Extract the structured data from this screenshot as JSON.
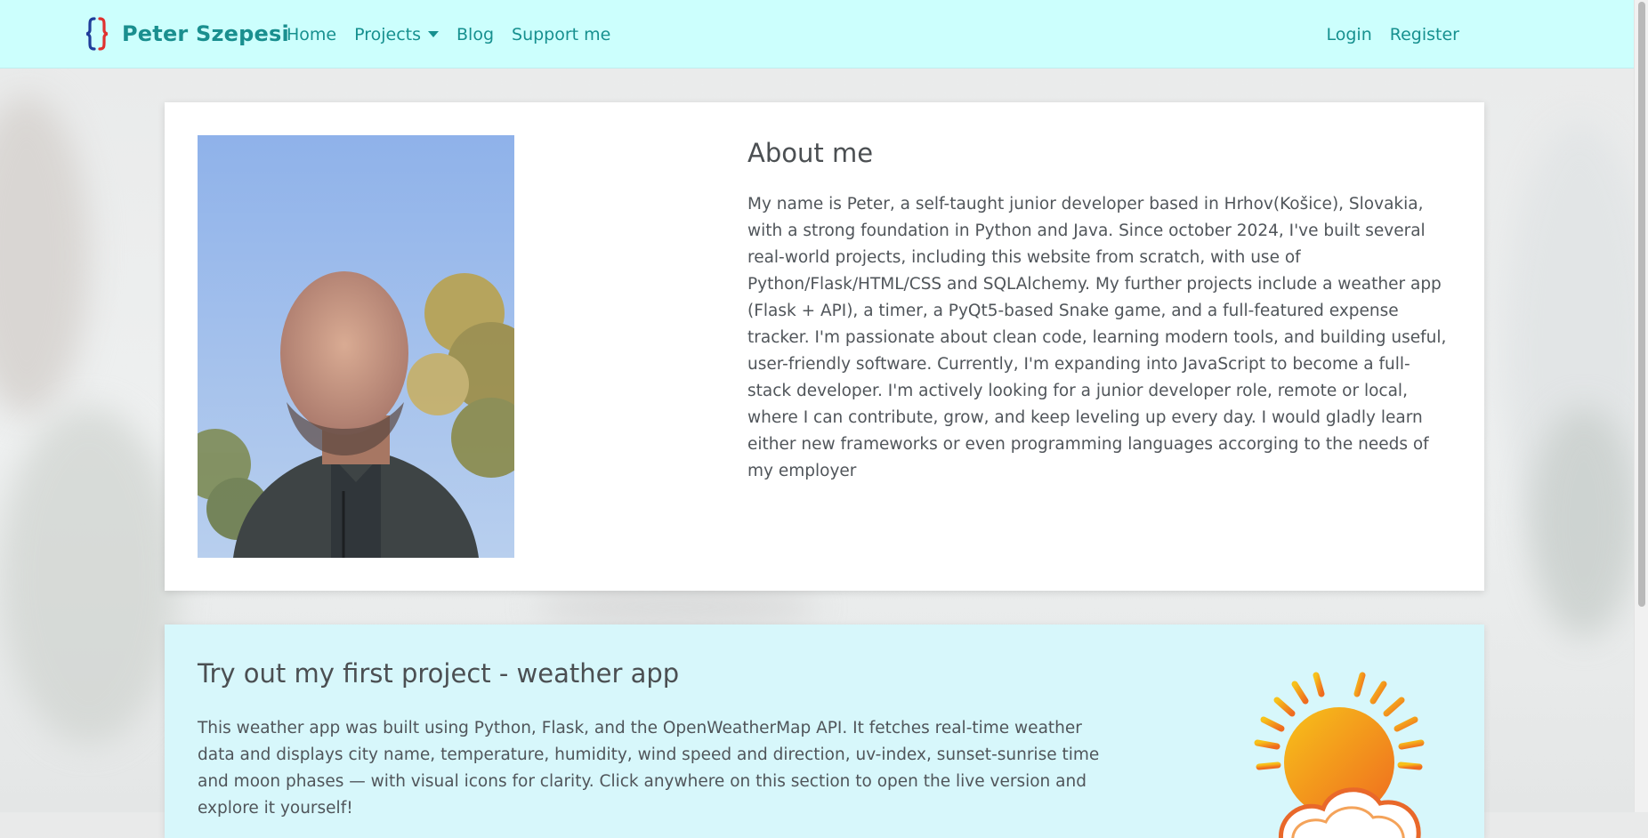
{
  "nav": {
    "brand_name": "Peter Szepesi",
    "brand_logo_text": "{}",
    "links": [
      "Home",
      "Projects",
      "Blog",
      "Support me"
    ],
    "auth": [
      "Login",
      "Register"
    ]
  },
  "about": {
    "title": "About me",
    "body": "My name is Peter, a self-taught junior developer based in Hrhov(Košice), Slovakia, with a strong foundation in Python and Java. Since october 2024, I've built several real-world projects, including this website from scratch, with use of Python/Flask/HTML/CSS and SQLAlchemy. My further projects include a weather app (Flask + API), a timer, a PyQt5-based Snake game, and a full-featured expense tracker. I'm passionate about clean code, learning modern tools, and building useful, user-friendly software. Currently, I'm expanding into JavaScript to become a full-stack developer. I'm actively looking for a junior developer role, remote or local, where I can contribute, grow, and keep leveling up every day. I would gladly learn either new frameworks or even programming languages accorging to the needs of my employer"
  },
  "weather_card": {
    "title": "Try out my first project - weather app",
    "body": "This weather app was built using Python, Flask, and the OpenWeatherMap API. It fetches real-time weather data and displays city name, temperature, humidity, wind speed and direction, uv-index, sunset-sunrise time and moon phases — with visual icons for clarity. Click anywhere on this section to open the live version and explore it yourself!"
  },
  "colors": {
    "navbar_bg": "#ccfffd",
    "link": "#16908f",
    "weather_card_bg": "#d7f7fb"
  },
  "icons": [
    "curly-braces-logo-icon",
    "caret-down-icon",
    "sun-cloud-icon"
  ]
}
